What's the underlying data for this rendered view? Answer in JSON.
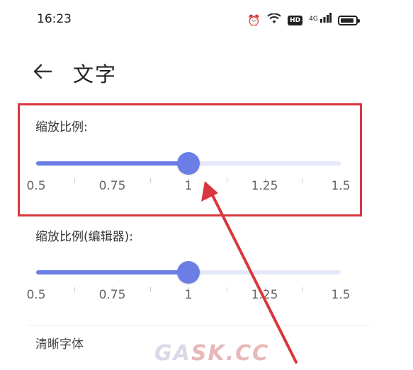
{
  "status_bar": {
    "time": "16:23",
    "icons": [
      "alarm-icon",
      "wifi-icon",
      "hd-icon",
      "signal-4g-icon",
      "battery-icon"
    ],
    "hd_label": "HD",
    "signal_label": "4G"
  },
  "header": {
    "title": "文字",
    "back_icon": "arrow-left-icon"
  },
  "sections": [
    {
      "label": "缩放比例:",
      "value": 1,
      "min": 0.5,
      "max": 1.5,
      "tick_labels": [
        "0.5",
        "0.75",
        "1",
        "1.25",
        "1.5"
      ]
    },
    {
      "label": "缩放比例(编辑器):",
      "value": 1,
      "min": 0.5,
      "max": 1.5,
      "tick_labels": [
        "0.5",
        "0.75",
        "1",
        "1.25",
        "1.5"
      ]
    }
  ],
  "next_item_label": "清晰字体",
  "watermark": {
    "part1": "GA",
    "part2": "SK.CC"
  },
  "colors": {
    "accent": "#6b7ee6",
    "track": "#e5e8f8",
    "annotation": "#d9363e"
  }
}
